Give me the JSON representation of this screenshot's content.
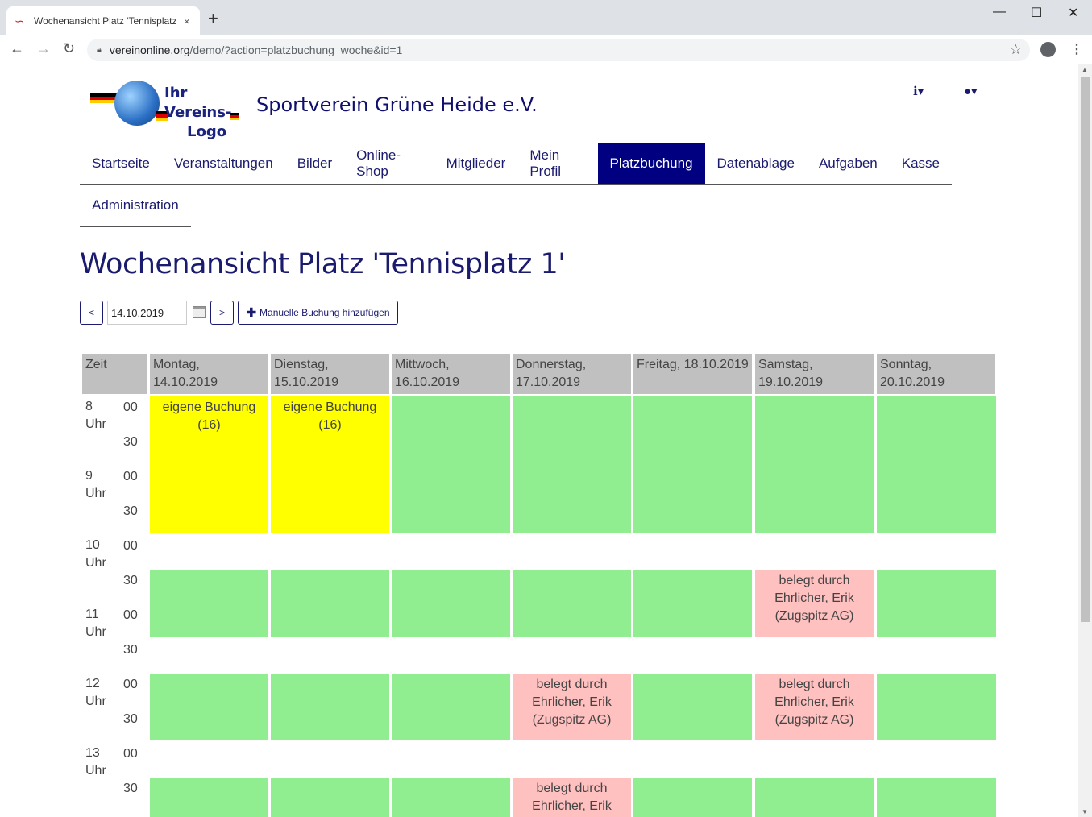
{
  "browser": {
    "tab_title": "Wochenansicht Platz 'Tennisplatz",
    "tab_close": "×",
    "new_tab": "+",
    "url_host": "vereinonline.org",
    "url_path": "/demo/?action=platzbuchung_woche&id=1",
    "window_controls": [
      "—",
      "☐",
      "✕"
    ]
  },
  "site": {
    "logo_line1": "Ihr Vereins-",
    "logo_line2": "Logo",
    "title": "Sportverein Grüne Heide e.V.",
    "info_icon": "info-circle-icon",
    "user_icon": "user-icon"
  },
  "nav": {
    "items": [
      "Startseite",
      "Veranstaltungen",
      "Bilder",
      "Online-Shop",
      "Mitglieder",
      "Mein Profil",
      "Platzbuchung",
      "Datenablage",
      "Aufgaben",
      "Kasse"
    ],
    "active": "Platzbuchung",
    "sub_items": [
      "Administration"
    ]
  },
  "page": {
    "heading": "Wochenansicht Platz 'Tennisplatz 1'",
    "prev_label": "<",
    "next_label": ">",
    "date_value": "14.10.2019",
    "add_booking_label": "Manuelle Buchung hinzufügen",
    "add_icon": "plus-icon"
  },
  "schedule": {
    "time_header": "Zeit",
    "days": [
      {
        "line1": "Montag,",
        "line2": "14.10.2019"
      },
      {
        "line1": "Dienstag,",
        "line2": "15.10.2019"
      },
      {
        "line1": "Mittwoch,",
        "line2": "16.10.2019"
      },
      {
        "line1": "Donnerstag,",
        "line2": "17.10.2019"
      },
      {
        "line1": "Freitag, 18.10.2019",
        "line2": ""
      },
      {
        "line1": "Samstag,",
        "line2": "19.10.2019"
      },
      {
        "line1": "Sonntag,",
        "line2": "20.10.2019"
      }
    ],
    "hours": [
      {
        "hour": "8",
        "unit": "Uhr"
      },
      {
        "hour": "9",
        "unit": "Uhr"
      },
      {
        "hour": "10",
        "unit": "Uhr"
      },
      {
        "hour": "11",
        "unit": "Uhr"
      },
      {
        "hour": "12",
        "unit": "Uhr"
      },
      {
        "hour": "13",
        "unit": "Uhr"
      }
    ],
    "minutes": [
      "00",
      "30"
    ],
    "own_booking_text": {
      "line1": "eigene Buchung",
      "line2": "(16)"
    },
    "taken_text": {
      "line1": "belegt durch",
      "line2": "Ehrlicher, Erik",
      "line3": "(Zugspitz AG)"
    }
  }
}
